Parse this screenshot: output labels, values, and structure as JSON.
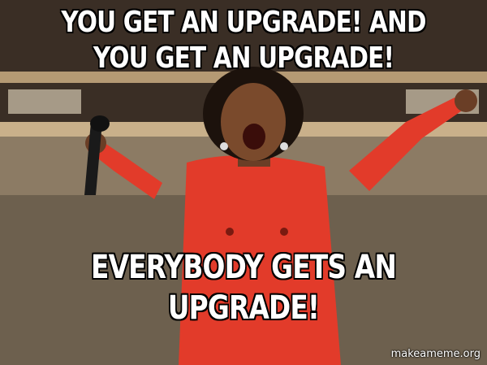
{
  "meme": {
    "top_text": "YOU GET AN UPGRADE! AND YOU GET AN UPGRADE!",
    "bottom_text": "EVERYBODY GETS AN UPGRADE!",
    "watermark": "makeameme.org"
  },
  "colors": {
    "dress": "#e23b2a",
    "background": "#3b2f26",
    "text": "#ffffff",
    "text_outline": "#000000"
  }
}
